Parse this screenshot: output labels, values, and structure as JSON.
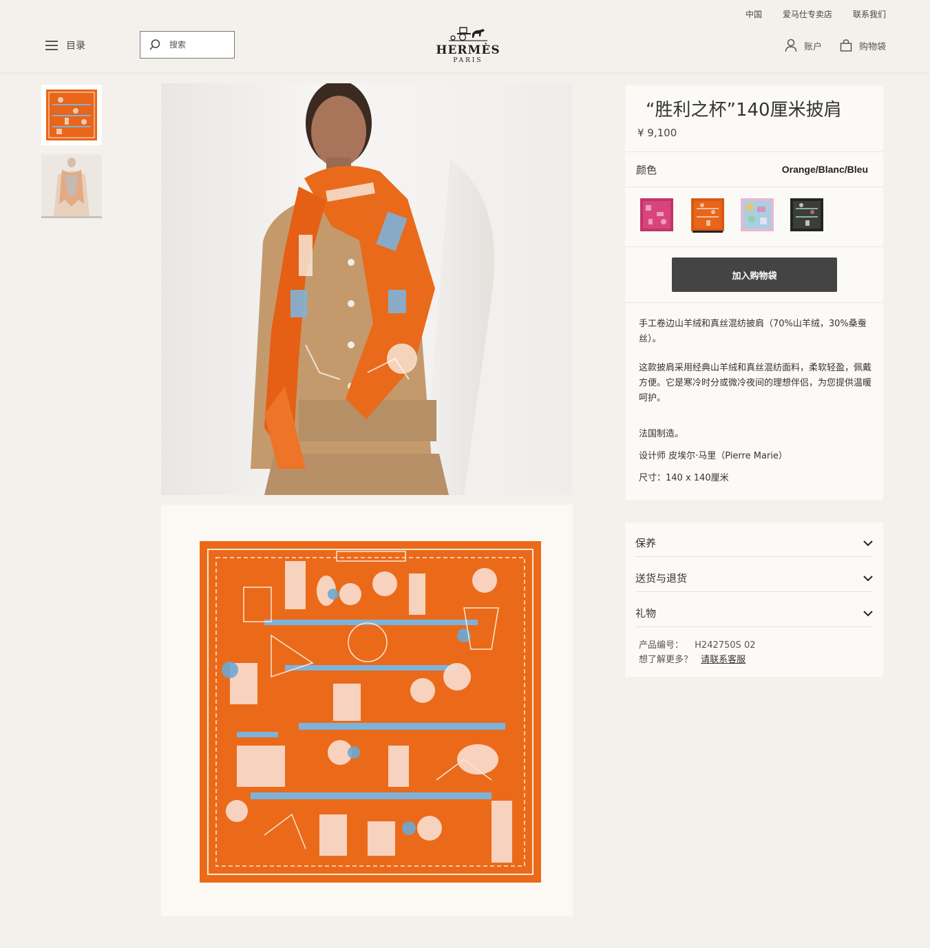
{
  "header": {
    "top_links": [
      "中国",
      "爱马仕专卖店",
      "联系我们"
    ],
    "menu_label": "目录",
    "search_placeholder": "搜索",
    "logo_brand": "HERMÈS",
    "logo_city": "PARIS",
    "account_label": "账户",
    "cart_label": "购物袋"
  },
  "product": {
    "title": "“胜利之杯”140厘米披肩",
    "price": "¥ 9,100",
    "color_label": "颜色",
    "color_value": "Orange/Blanc/Bleu",
    "swatches": [
      {
        "name": "pink",
        "color": "#d8447c"
      },
      {
        "name": "orange",
        "color": "#e8651a",
        "selected": true
      },
      {
        "name": "multicolor",
        "color": "#9fc7d8"
      },
      {
        "name": "black",
        "color": "#3a3d3a"
      }
    ],
    "add_to_cart": "加入购物袋",
    "desc_1": "手工卷边山羊绒和真丝混纺披肩（70%山羊绒，30%桑蚕丝）。",
    "desc_2": "这款披肩采用经典山羊绒和真丝混纺面料，柔软轻盈，佩戴方便。它是寒冷时分或微冷夜间的理想伴侣，为您提供温暖呵护。",
    "made_in": "法国制造。",
    "designer": "设计师 皮埃尔·马里（Pierre Marie）",
    "size": "尺寸：140 x 140厘米"
  },
  "accordion": {
    "care": "保养",
    "shipping": "送货与退货",
    "gift": "礼物"
  },
  "meta": {
    "sku_label": "产品编号：",
    "sku": "H242750S 02",
    "more_label": "想了解更多？",
    "contact_link": "请联系客服"
  },
  "colors": {
    "accent_orange": "#e8651a",
    "button_dark": "#444444",
    "page_bg": "#f4f1ec"
  }
}
